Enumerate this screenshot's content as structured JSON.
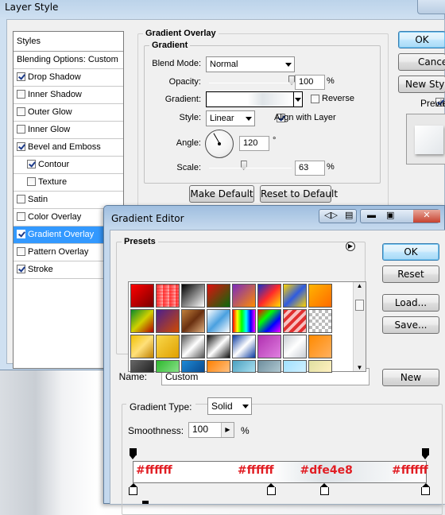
{
  "layer_style": {
    "title": "Layer Style",
    "styles_header": "Styles",
    "items": [
      {
        "label": "Blending Options: Custom",
        "check": null,
        "sub": false,
        "selected": false
      },
      {
        "label": "Drop Shadow",
        "check": true,
        "sub": false,
        "selected": false
      },
      {
        "label": "Inner Shadow",
        "check": false,
        "sub": false,
        "selected": false
      },
      {
        "label": "Outer Glow",
        "check": false,
        "sub": false,
        "selected": false
      },
      {
        "label": "Inner Glow",
        "check": false,
        "sub": false,
        "selected": false
      },
      {
        "label": "Bevel and Emboss",
        "check": true,
        "sub": false,
        "selected": false
      },
      {
        "label": "Contour",
        "check": true,
        "sub": true,
        "selected": false
      },
      {
        "label": "Texture",
        "check": false,
        "sub": true,
        "selected": false
      },
      {
        "label": "Satin",
        "check": false,
        "sub": false,
        "selected": false
      },
      {
        "label": "Color Overlay",
        "check": false,
        "sub": false,
        "selected": false
      },
      {
        "label": "Gradient Overlay",
        "check": true,
        "sub": false,
        "selected": true
      },
      {
        "label": "Pattern Overlay",
        "check": false,
        "sub": false,
        "selected": false
      },
      {
        "label": "Stroke",
        "check": true,
        "sub": false,
        "selected": false
      }
    ],
    "section_title": "Gradient Overlay",
    "group_title": "Gradient",
    "blend_mode_label": "Blend Mode:",
    "blend_mode_value": "Normal",
    "opacity_label": "Opacity:",
    "opacity_value": "100",
    "opacity_unit": "%",
    "opacity_level": 1.0,
    "gradient_label": "Gradient:",
    "reverse_label": "Reverse",
    "reverse_checked": false,
    "style_label": "Style:",
    "style_value": "Linear",
    "align_label": "Align with Layer",
    "align_checked": true,
    "angle_label": "Angle:",
    "angle_value": "120",
    "angle_unit": "°",
    "scale_label": "Scale:",
    "scale_value": "63",
    "scale_unit": "%",
    "make_default": "Make Default",
    "reset_default": "Reset to Default",
    "ok": "OK",
    "cancel": "Cance",
    "new_style": "New Style",
    "preview_label": "Previe",
    "preview_checked": true
  },
  "gradient_editor": {
    "title": "Gradient Editor",
    "presets_label": "Presets",
    "ok": "OK",
    "reset": "Reset",
    "load": "Load...",
    "save": "Save...",
    "name_label": "Name:",
    "name_value": "Custom",
    "new_button": "New",
    "gradient_type_label": "Gradient Type:",
    "gradient_type_value": "Solid",
    "smoothness_label": "Smoothness:",
    "smoothness_value": "100",
    "smoothness_unit": "%",
    "stop_labels": [
      "#ffffff",
      "#ffffff",
      "#dfe4e8",
      "#ffffff"
    ],
    "color_stops": [
      {
        "location": 0.0,
        "color": "#ffffff"
      },
      {
        "location": 0.47,
        "color": "#ffffff"
      },
      {
        "location": 0.65,
        "color": "#dfe4e8"
      },
      {
        "location": 1.0,
        "color": "#ffffff"
      }
    ]
  },
  "colors": {
    "selection": "#3399ff",
    "annotation_red": "#e11d23"
  }
}
